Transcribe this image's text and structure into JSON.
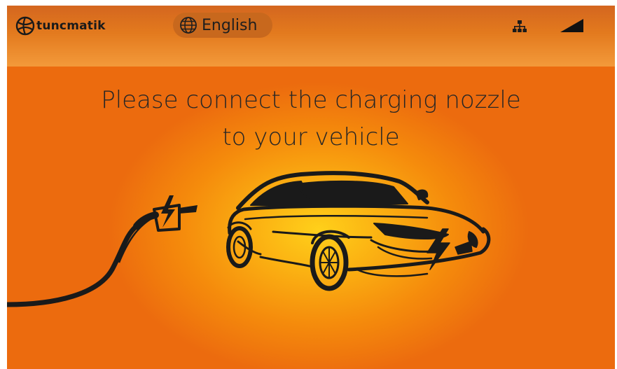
{
  "header": {
    "brand": "tuncmatik",
    "language_label": "English",
    "icons": {
      "logo": "tuncmatik-globe-logo",
      "language": "globe-icon",
      "network": "network-icon",
      "signal": "signal-strength-icon"
    }
  },
  "main": {
    "message_line1": "Please connect the charging nozzle",
    "message_line2": "to your vehicle",
    "illustration": "car-and-charging-nozzle"
  },
  "colors": {
    "background": "#ec6b0e",
    "header_top": "#d4661f",
    "glow": "#ffd01a",
    "text": "#262626"
  }
}
